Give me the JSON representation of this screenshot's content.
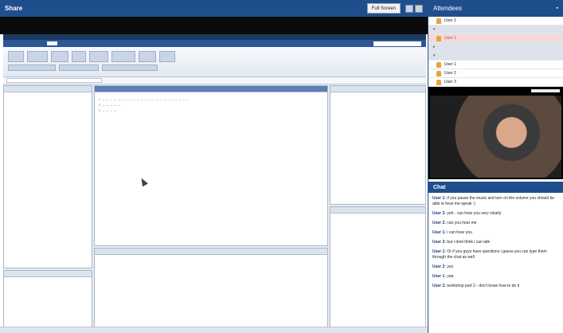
{
  "share": {
    "title": "Share",
    "fullscreen_label": "Full Screen"
  },
  "attendees": {
    "title": "Attendees",
    "users": [
      {
        "label": "User 1"
      },
      {
        "label": "User 1"
      },
      {
        "label": "User 1"
      },
      {
        "label": "User 2"
      },
      {
        "label": "User 3"
      }
    ]
  },
  "chat": {
    "title": "Chat",
    "messages": [
      {
        "user": "User 1:",
        "text": "if you pause the music and turn on the volume you should be able to hear me speak :)"
      },
      {
        "user": "User 2:",
        "text": "yeh - can hear you very clearly"
      },
      {
        "user": "User 2:",
        "text": "can you hear me"
      },
      {
        "user": "User 1:",
        "text": "i can hear you"
      },
      {
        "user": "User 2:",
        "text": "but i dont think i can talk"
      },
      {
        "user": "User 1:",
        "text": "Or if you guys have questions i guess you can type them through the chat as well"
      },
      {
        "user": "User 2:",
        "text": "yes"
      },
      {
        "user": "User 1:",
        "text": "yep"
      },
      {
        "user": "User 2:",
        "text": "workshop part 2 - don't know how to do it"
      }
    ]
  },
  "colors": {
    "header_blue": "#1f4e8c",
    "editor_blue": "#5b7fb6"
  },
  "icons": [
    "grid-icon",
    "person-icon",
    "cursor-icon"
  ]
}
